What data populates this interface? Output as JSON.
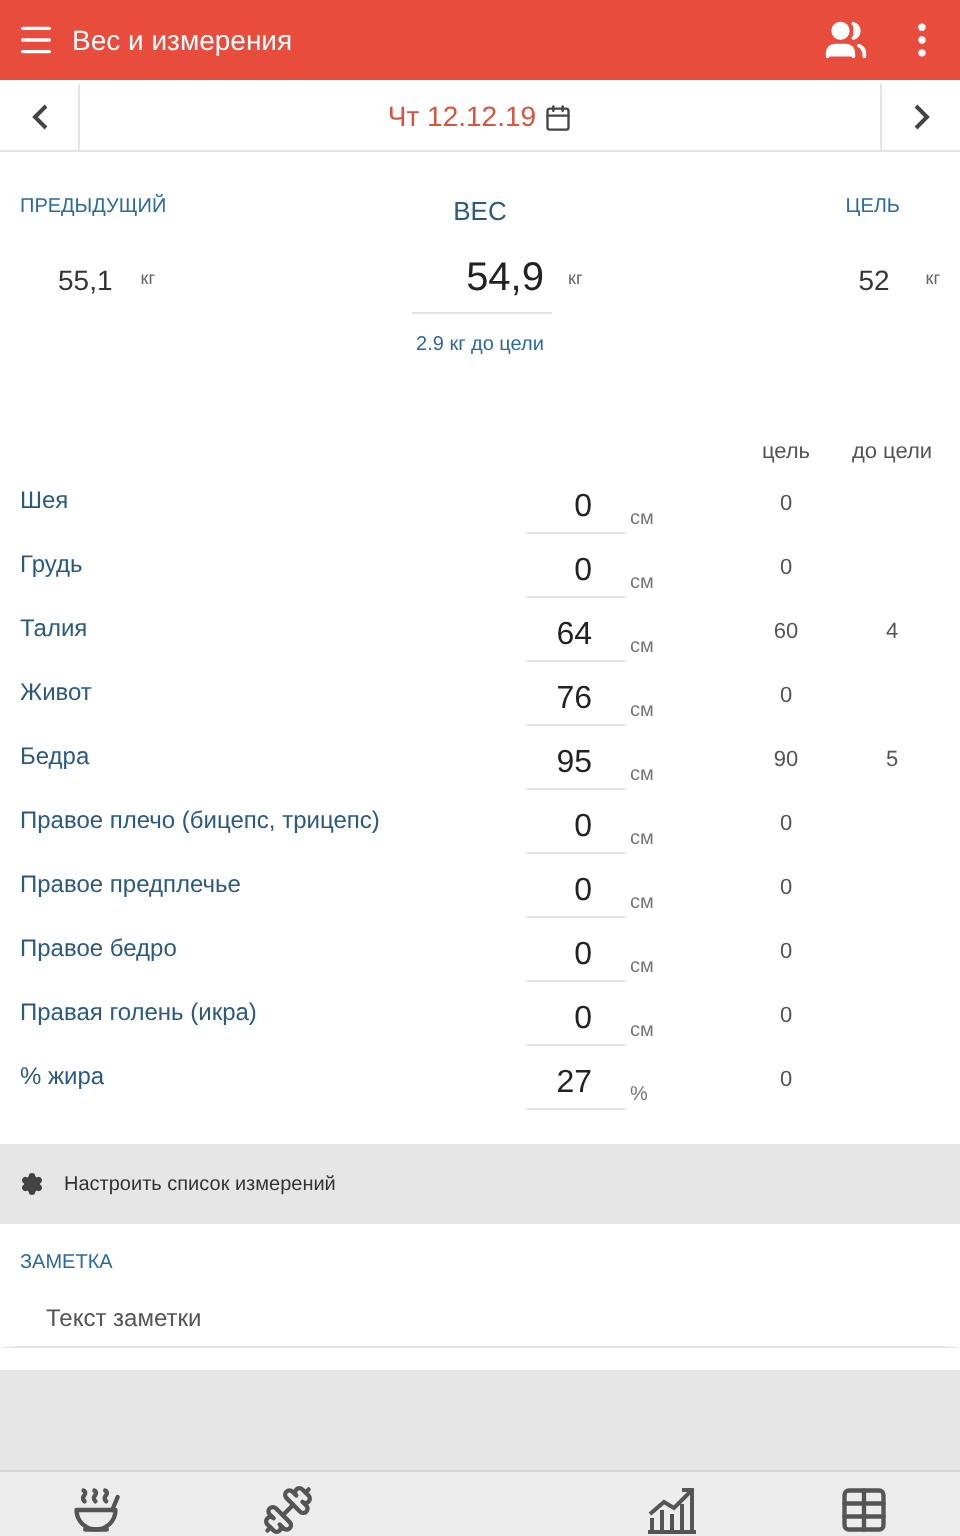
{
  "app_bar": {
    "title": "Вес и измерения"
  },
  "date_bar": {
    "date": "Чт 12.12.19"
  },
  "weight": {
    "previous_label": "ПРЕДЫДУЩИЙ",
    "previous_value": "55,1",
    "previous_unit": "кг",
    "title": "ВЕС",
    "value": "54,9",
    "unit": "кг",
    "goal_label": "ЦЕЛЬ",
    "goal_value": "52",
    "goal_unit": "кг",
    "to_goal": "2.9 кг до цели"
  },
  "measurements": {
    "columns": [
      "цель",
      "до цели"
    ],
    "rows": [
      {
        "name": "Шея",
        "value": "0",
        "unit": "см",
        "goal": "0"
      },
      {
        "name": "Грудь",
        "value": "0",
        "unit": "см",
        "goal": "0"
      },
      {
        "name": "Талия",
        "value": "64",
        "unit": "см",
        "goal": "60",
        "to_goal": "4"
      },
      {
        "name": "Живот",
        "value": "76",
        "unit": "см",
        "goal": "0"
      },
      {
        "name": "Бедра",
        "value": "95",
        "unit": "см",
        "goal": "90",
        "to_goal": "5"
      },
      {
        "name": "Правое плечо (бицепс, трицепс)",
        "value": "0",
        "unit": "см",
        "goal": "0"
      },
      {
        "name": "Правое предплечье",
        "value": "0",
        "unit": "см",
        "goal": "0"
      },
      {
        "name": "Правое бедро",
        "value": "0",
        "unit": "см",
        "goal": "0"
      },
      {
        "name": "Правая голень (икра)",
        "value": "0",
        "unit": "см",
        "goal": "0"
      },
      {
        "name": "% жира",
        "value": "27",
        "unit": "%",
        "goal": "0"
      }
    ]
  },
  "settings_link": "Настроить список измерений",
  "note": {
    "label": "ЗАМЕТКА",
    "placeholder": "Текст заметки"
  },
  "bottom_nav": [
    {
      "kind": "food"
    },
    {
      "kind": "exercise"
    },
    {
      "kind": "empty"
    },
    {
      "kind": "chart"
    },
    {
      "kind": "table"
    }
  ]
}
